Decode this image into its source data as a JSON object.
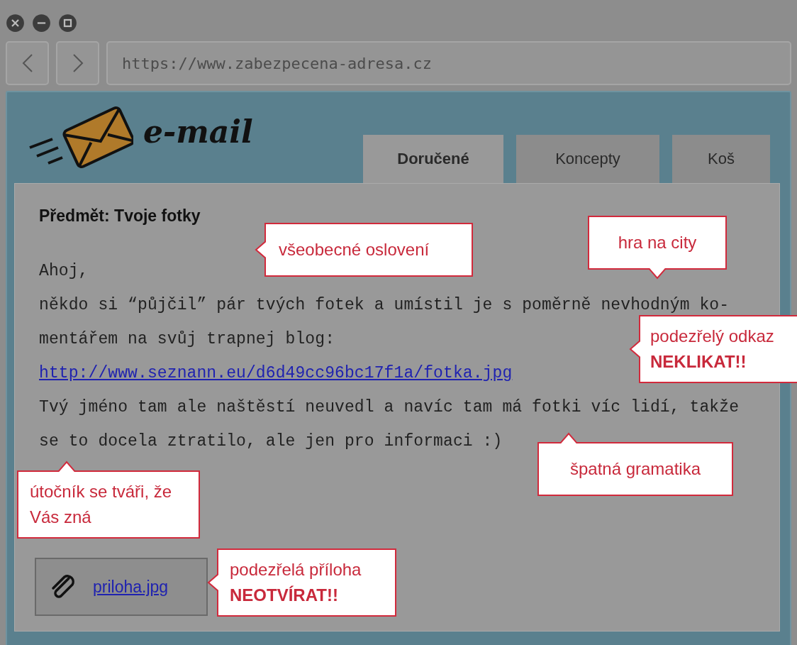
{
  "browser": {
    "url": "https://www.zabezpecena-adresa.cz"
  },
  "app": {
    "logo": "e-mail",
    "tabs": [
      {
        "label": "Doručené",
        "selected": true
      },
      {
        "label": "Koncepty",
        "selected": false
      },
      {
        "label": "Koš",
        "selected": false
      }
    ]
  },
  "email": {
    "subject": "Předmět: Tvoje fotky",
    "body": [
      {
        "kind": "text",
        "text": "Ahoj,"
      },
      {
        "kind": "text",
        "text": "někdo si “půjčil” pár tvých fotek a umístil je s poměrně nevhodným ko-"
      },
      {
        "kind": "text",
        "text": "mentářem na svůj trapnej blog:"
      },
      {
        "kind": "link",
        "text": "http://www.seznann.eu/d6d49cc96bc17f1a/fotka.jpg"
      },
      {
        "kind": "text",
        "text": "Tvý jméno tam ale naštěstí neuvedl a navíc tam má fotki víc lidí, takže"
      },
      {
        "kind": "text",
        "text": "se to docela ztratilo, ale jen pro informaci :)"
      }
    ],
    "attachment": "priloha.jpg"
  },
  "callouts": [
    {
      "text": "všeobecné oslovení"
    },
    {
      "text": "hra na city"
    },
    {
      "text": "podezřelý odkaz",
      "warning": "NEKLIKAT!!"
    },
    {
      "text": "špatná gramatika"
    },
    {
      "text": "útočník se tváři, že Vás zná"
    },
    {
      "text": "podezřelá příloha",
      "warning": "NEOTVÍRAT!!"
    }
  ]
}
